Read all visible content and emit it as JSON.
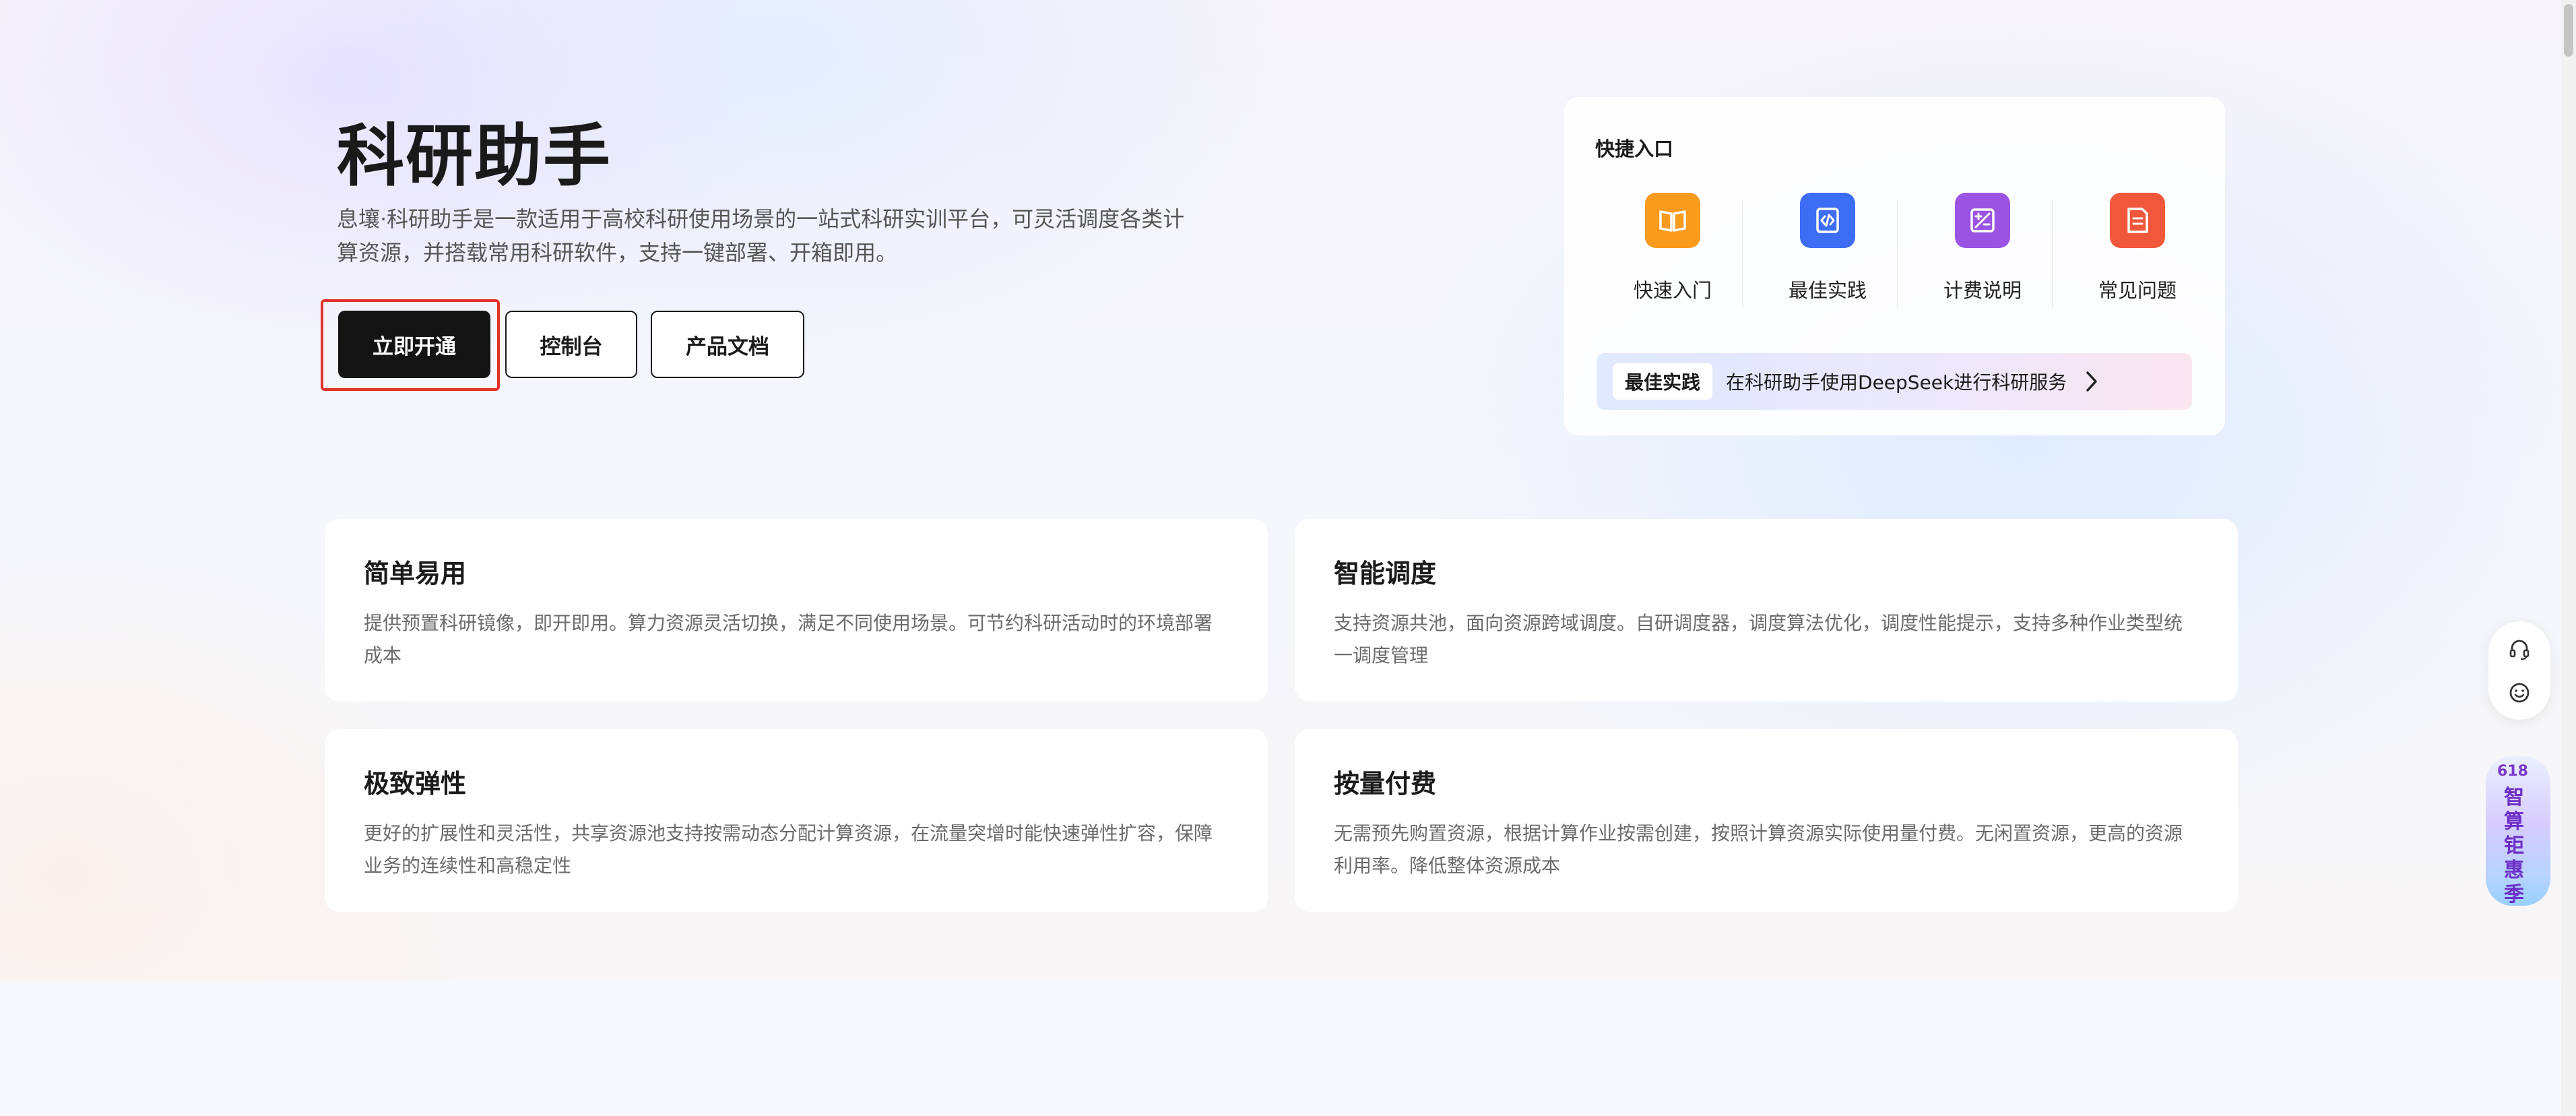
{
  "hero": {
    "title": "科研助手",
    "description": "息壤·科研助手是一款适用于高校科研使用场景的一站式科研实训平台，可灵活调度各类计算资源，并搭载常用科研软件，支持一键部署、开箱即用。",
    "buttons": {
      "primary": "立即开通",
      "console": "控制台",
      "docs": "产品文档"
    }
  },
  "quick_entry": {
    "title": "快捷入口",
    "items": [
      {
        "label": "快速入门",
        "icon": "book-icon",
        "color": "#fb9b1e"
      },
      {
        "label": "最佳实践",
        "icon": "code-doc-icon",
        "color": "#3d6cf5"
      },
      {
        "label": "计费说明",
        "icon": "calculator-icon",
        "color": "#9b53e3"
      },
      {
        "label": "常见问题",
        "icon": "document-icon",
        "color": "#f0573b"
      }
    ],
    "banner": {
      "tag": "最佳实践",
      "text": "在科研助手使用DeepSeek进行科研服务"
    }
  },
  "features": [
    {
      "title": "简单易用",
      "desc": "提供预置科研镜像，即开即用。算力资源灵活切换，满足不同使用场景。可节约科研活动时的环境部署成本"
    },
    {
      "title": "智能调度",
      "desc": "支持资源共池，面向资源跨域调度。自研调度器，调度算法优化，调度性能提示，支持多种作业类型统一调度管理"
    },
    {
      "title": "极致弹性",
      "desc": "更好的扩展性和灵活性，共享资源池支持按需动态分配计算资源，在流量突增时能快速弹性扩容，保障业务的连续性和高稳定性"
    },
    {
      "title": "按量付费",
      "desc": "无需预先购置资源，根据计算作业按需创建，按照计算资源实际使用量付费。无闲置资源，更高的资源利用率。降低整体资源成本"
    }
  ],
  "floating": {
    "promo_top": "618",
    "promo_chars": [
      "智",
      "算",
      "钜",
      "惠",
      "季"
    ]
  }
}
